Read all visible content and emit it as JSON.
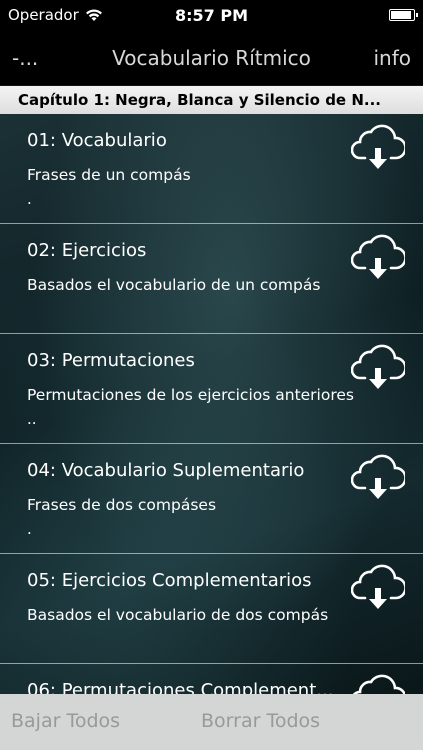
{
  "status": {
    "carrier": "Operador",
    "time": "8:57 PM",
    "battery_level": 0.95
  },
  "nav": {
    "back_label": "-...",
    "title": "Vocabulario Rítmico",
    "info_label": "info"
  },
  "section": {
    "title": "Capítulo 1: Negra, Blanca y Silencio de N..."
  },
  "items": [
    {
      "title": "01: Vocabulario",
      "subtitle": "Frases de un compás",
      "dots": ".",
      "icon": "download-cloud-icon"
    },
    {
      "title": "02: Ejercicios",
      "subtitle": "Basados el vocabulario de un compás",
      "dots": "",
      "icon": "download-cloud-icon"
    },
    {
      "title": "03: Permutaciones",
      "subtitle": "Permutaciones de los ejercicios anteriores",
      "dots": "..",
      "icon": "download-cloud-icon"
    },
    {
      "title": "04: Vocabulario Suplementario",
      "subtitle": "Frases de dos compáses",
      "dots": ".",
      "icon": "download-cloud-icon"
    },
    {
      "title": "05: Ejercicios Complementarios",
      "subtitle": "Basados el vocabulario de dos compás",
      "dots": "",
      "icon": "download-cloud-icon"
    },
    {
      "title": "06: Permutaciones Complement...",
      "subtitle": "",
      "dots": "",
      "icon": "download-cloud-icon"
    }
  ],
  "toolbar": {
    "download_all": "Bajar Todos",
    "delete_all": "Borrar Todos"
  }
}
